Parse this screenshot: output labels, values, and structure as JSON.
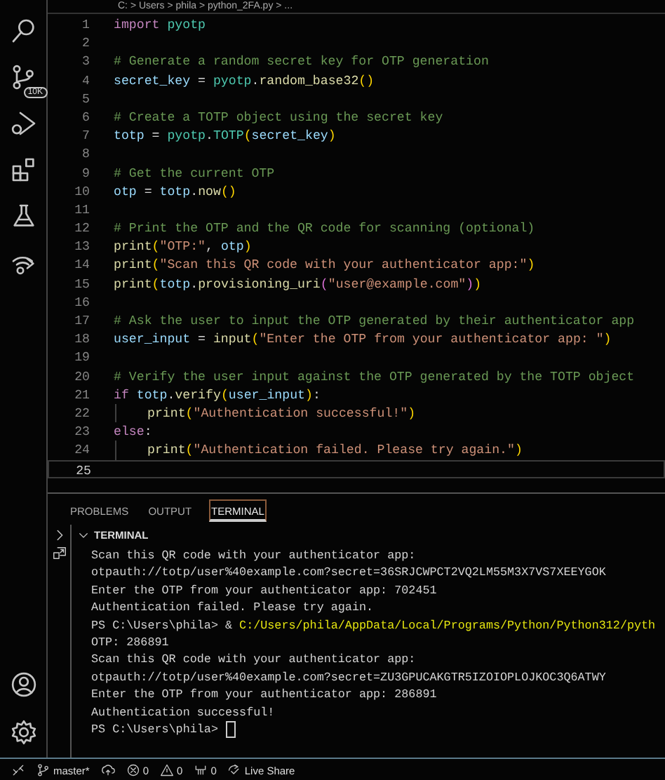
{
  "activity_bar": {
    "items": [
      {
        "kind": "search"
      },
      {
        "kind": "source-control",
        "badge": "10K"
      },
      {
        "kind": "debug"
      },
      {
        "kind": "extensions"
      },
      {
        "kind": "testing"
      },
      {
        "kind": "remote"
      }
    ],
    "bottom_items": [
      {
        "kind": "account"
      },
      {
        "kind": "settings"
      }
    ]
  },
  "breadcrumb": "C: > Users > phila > python_2FA.py > ...",
  "editor": {
    "lines": [
      {
        "number": "1",
        "current": false,
        "tokens": [
          {
            "kind": "kw",
            "text": "import "
          },
          {
            "kind": "mod",
            "text": "pyotp"
          }
        ]
      },
      {
        "number": "2",
        "current": false
      },
      {
        "number": "3",
        "current": false,
        "tokens": [
          {
            "kind": "comment",
            "text": "# Generate a random secret key for OTP generation"
          }
        ]
      },
      {
        "number": "4",
        "current": false,
        "tokens": [
          {
            "kind": "var",
            "text": "secret_key"
          },
          {
            "kind": "plain",
            "text": " = "
          },
          {
            "kind": "mod",
            "text": "pyotp"
          },
          {
            "kind": "plain",
            "text": "."
          },
          {
            "kind": "fn",
            "text": "random_base32"
          },
          {
            "kind": "paren",
            "text": "()"
          }
        ]
      },
      {
        "number": "5",
        "current": false
      },
      {
        "number": "6",
        "current": false,
        "tokens": [
          {
            "kind": "comment",
            "text": "# Create a TOTP object using the secret key"
          }
        ]
      },
      {
        "number": "7",
        "current": false,
        "tokens": [
          {
            "kind": "var",
            "text": "totp"
          },
          {
            "kind": "plain",
            "text": " = "
          },
          {
            "kind": "mod",
            "text": "pyotp"
          },
          {
            "kind": "plain",
            "text": "."
          },
          {
            "kind": "mod",
            "text": "TOTP"
          },
          {
            "kind": "paren",
            "text": "("
          },
          {
            "kind": "var",
            "text": "secret_key"
          },
          {
            "kind": "paren",
            "text": ")"
          }
        ]
      },
      {
        "number": "8",
        "current": false
      },
      {
        "number": "9",
        "current": false,
        "tokens": [
          {
            "kind": "comment",
            "text": "# Get the current OTP"
          }
        ]
      },
      {
        "number": "10",
        "current": false,
        "tokens": [
          {
            "kind": "var",
            "text": "otp"
          },
          {
            "kind": "plain",
            "text": " = "
          },
          {
            "kind": "var",
            "text": "totp"
          },
          {
            "kind": "plain",
            "text": "."
          },
          {
            "kind": "fn",
            "text": "now"
          },
          {
            "kind": "paren",
            "text": "()"
          }
        ]
      },
      {
        "number": "11",
        "current": false
      },
      {
        "number": "12",
        "current": false,
        "tokens": [
          {
            "kind": "comment",
            "text": "# Print the OTP and the QR code for scanning (optional)"
          }
        ]
      },
      {
        "number": "13",
        "current": false,
        "tokens": [
          {
            "kind": "fn",
            "text": "print"
          },
          {
            "kind": "paren",
            "text": "("
          },
          {
            "kind": "str",
            "text": "\"OTP:\""
          },
          {
            "kind": "plain",
            "text": ", "
          },
          {
            "kind": "var",
            "text": "otp"
          },
          {
            "kind": "paren",
            "text": ")"
          }
        ]
      },
      {
        "number": "14",
        "current": false,
        "tokens": [
          {
            "kind": "fn",
            "text": "print"
          },
          {
            "kind": "paren",
            "text": "("
          },
          {
            "kind": "str",
            "text": "\"Scan this QR code with your authenticator app:\""
          },
          {
            "kind": "paren",
            "text": ")"
          }
        ]
      },
      {
        "number": "15",
        "current": false,
        "tokens": [
          {
            "kind": "fn",
            "text": "print"
          },
          {
            "kind": "paren",
            "text": "("
          },
          {
            "kind": "var",
            "text": "totp"
          },
          {
            "kind": "plain",
            "text": "."
          },
          {
            "kind": "fn",
            "text": "provisioning_uri"
          },
          {
            "kind": "paren2",
            "text": "("
          },
          {
            "kind": "str",
            "text": "\"user@example.com\""
          },
          {
            "kind": "paren2",
            "text": ")"
          },
          {
            "kind": "paren",
            "text": ")"
          }
        ]
      },
      {
        "number": "16",
        "current": false
      },
      {
        "number": "17",
        "current": false,
        "tokens": [
          {
            "kind": "comment",
            "text": "# Ask the user to input the OTP generated by their authenticator app"
          }
        ]
      },
      {
        "number": "18",
        "current": false,
        "tokens": [
          {
            "kind": "var",
            "text": "user_input"
          },
          {
            "kind": "plain",
            "text": " = "
          },
          {
            "kind": "fn",
            "text": "input"
          },
          {
            "kind": "paren",
            "text": "("
          },
          {
            "kind": "str",
            "text": "\"Enter the OTP from your authenticator app: \""
          },
          {
            "kind": "paren",
            "text": ")"
          }
        ]
      },
      {
        "number": "19",
        "current": false
      },
      {
        "number": "20",
        "current": false,
        "tokens": [
          {
            "kind": "comment",
            "text": "# Verify the user input against the OTP generated by the TOTP object"
          }
        ]
      },
      {
        "number": "21",
        "current": false,
        "tokens": [
          {
            "kind": "kw",
            "text": "if "
          },
          {
            "kind": "var",
            "text": "totp"
          },
          {
            "kind": "plain",
            "text": "."
          },
          {
            "kind": "fn",
            "text": "verify"
          },
          {
            "kind": "paren",
            "text": "("
          },
          {
            "kind": "var",
            "text": "user_input"
          },
          {
            "kind": "paren",
            "text": ")"
          },
          {
            "kind": "plain",
            "text": ":"
          }
        ]
      },
      {
        "number": "22",
        "current": false,
        "indented": true,
        "tokens": [
          {
            "kind": "fn",
            "text": "print"
          },
          {
            "kind": "paren",
            "text": "("
          },
          {
            "kind": "str",
            "text": "\"Authentication successful!\""
          },
          {
            "kind": "paren",
            "text": ")"
          }
        ]
      },
      {
        "number": "23",
        "current": false,
        "tokens": [
          {
            "kind": "kw",
            "text": "else"
          },
          {
            "kind": "plain",
            "text": ":"
          }
        ]
      },
      {
        "number": "24",
        "current": false,
        "indented": true,
        "tokens": [
          {
            "kind": "fn",
            "text": "print"
          },
          {
            "kind": "paren",
            "text": "("
          },
          {
            "kind": "str",
            "text": "\"Authentication failed. Please try again.\""
          },
          {
            "kind": "paren",
            "text": ")"
          }
        ]
      },
      {
        "number": "25",
        "current": true
      }
    ]
  },
  "panel": {
    "tabs": [
      {
        "label": "PROBLEMS",
        "selected": false
      },
      {
        "label": "OUTPUT",
        "selected": false
      },
      {
        "label": "TERMINAL",
        "selected": true
      }
    ],
    "section": {
      "title": "TERMINAL",
      "expanded": true
    },
    "terminal_lines": [
      {
        "tokens": [
          {
            "kind": "plain",
            "text": "Scan this QR code with your authenticator app:"
          }
        ]
      },
      {
        "tokens": [
          {
            "kind": "plain",
            "text": "otpauth://totp/user%40example.com?secret=36SRJCWPCT2VQ2LM55M3X7VS7XEEYGOK"
          }
        ]
      },
      {
        "tokens": [
          {
            "kind": "plain",
            "text": "Enter the OTP from your authenticator app: 702451"
          }
        ]
      },
      {
        "tokens": [
          {
            "kind": "plain",
            "text": "Authentication failed. Please try again."
          }
        ]
      },
      {
        "tokens": [
          {
            "kind": "plain",
            "text": "PS C:\\Users\\phila> & "
          },
          {
            "kind": "path",
            "text": "C:/Users/phila/AppData/Local/Programs/Python/Python312/pyth"
          }
        ]
      },
      {
        "tokens": [
          {
            "kind": "plain",
            "text": "OTP: 286891"
          }
        ]
      },
      {
        "tokens": [
          {
            "kind": "plain",
            "text": "Scan this QR code with your authenticator app:"
          }
        ]
      },
      {
        "tokens": [
          {
            "kind": "plain",
            "text": "otpauth://totp/user%40example.com?secret=ZU3GPUCAKGTR5IZOIOPLOJKOC3Q6ATWY"
          }
        ]
      },
      {
        "tokens": [
          {
            "kind": "plain",
            "text": "Enter the OTP from your authenticator app: 286891"
          }
        ]
      },
      {
        "tokens": [
          {
            "kind": "plain",
            "text": "Authentication successful!"
          }
        ]
      },
      {
        "cursor": true,
        "tokens": [
          {
            "kind": "plain",
            "text": "PS C:\\Users\\phila> "
          }
        ]
      }
    ]
  },
  "status_bar": [
    {
      "kind": "remote"
    },
    {
      "kind": "branch",
      "text": "master*"
    },
    {
      "kind": "sync"
    },
    {
      "kind": "errors",
      "text": "0"
    },
    {
      "kind": "warnings",
      "text": "0"
    },
    {
      "kind": "ports",
      "text": "0"
    },
    {
      "kind": "liveshare",
      "text": "Live Share"
    }
  ]
}
